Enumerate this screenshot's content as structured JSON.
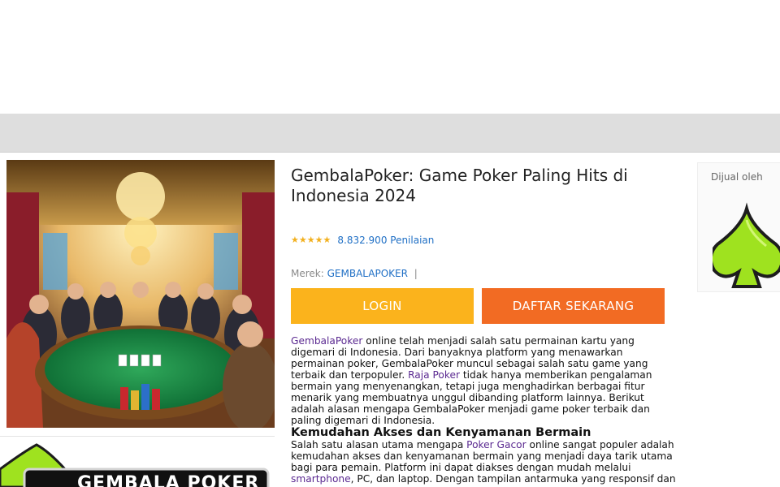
{
  "header": {},
  "product": {
    "title": "GembalaPoker: Game Poker Paling Hits di Indonesia 2024",
    "rating_count": "8.832.900 Penilaian",
    "rating_stars": 5,
    "brand_label": "Merek:",
    "brand_name": "GEMBALAPOKER",
    "brand_separator": "|"
  },
  "buttons": {
    "login": "LOGIN",
    "daftar": "DAFTAR SEKARANG"
  },
  "article": {
    "p1_link": "GembalaPoker",
    "p1_text_a": " online telah menjadi salah satu permainan kartu yang digemari di Indonesia. Dari banyaknya platform yang menawarkan permainan poker, GembalaPoker muncul sebagai salah satu game yang terbaik dan terpopuler. ",
    "p1_link2": "Raja Poker",
    "p1_text_b": " tidak hanya memberikan pengalaman bermain yang menyenangkan, tetapi juga menghadirkan berbagai fitur menarik yang membuatnya unggul dibanding platform lainnya. Berikut adalah alasan mengapa GembalaPoker menjadi game poker terbaik dan paling digemari di Indonesia.",
    "h2": "Kemudahan Akses dan Kenyamanan Bermain",
    "p2_text_a": "Salah satu alasan utama mengapa ",
    "p2_link": "Poker Gacor",
    "p2_text_b": " online sangat populer adalah kemudahan akses dan kenyamanan bermain yang menjadi daya tarik utama bagi para pemain. Platform ini dapat diakses dengan mudah melalui ",
    "p2_link2": "smartphone",
    "p2_text_c": ", PC, dan laptop. Dengan tampilan antarmuka yang responsif dan"
  },
  "seller": {
    "label": "Dijual oleh"
  },
  "thumbnail": {
    "logo_text": "GEMBALA POKER"
  },
  "colors": {
    "login": "#fbb31c",
    "daftar": "#f26b23",
    "link": "#1f6fc5",
    "article_link": "#5b2a91",
    "star": "#f2b01e"
  }
}
